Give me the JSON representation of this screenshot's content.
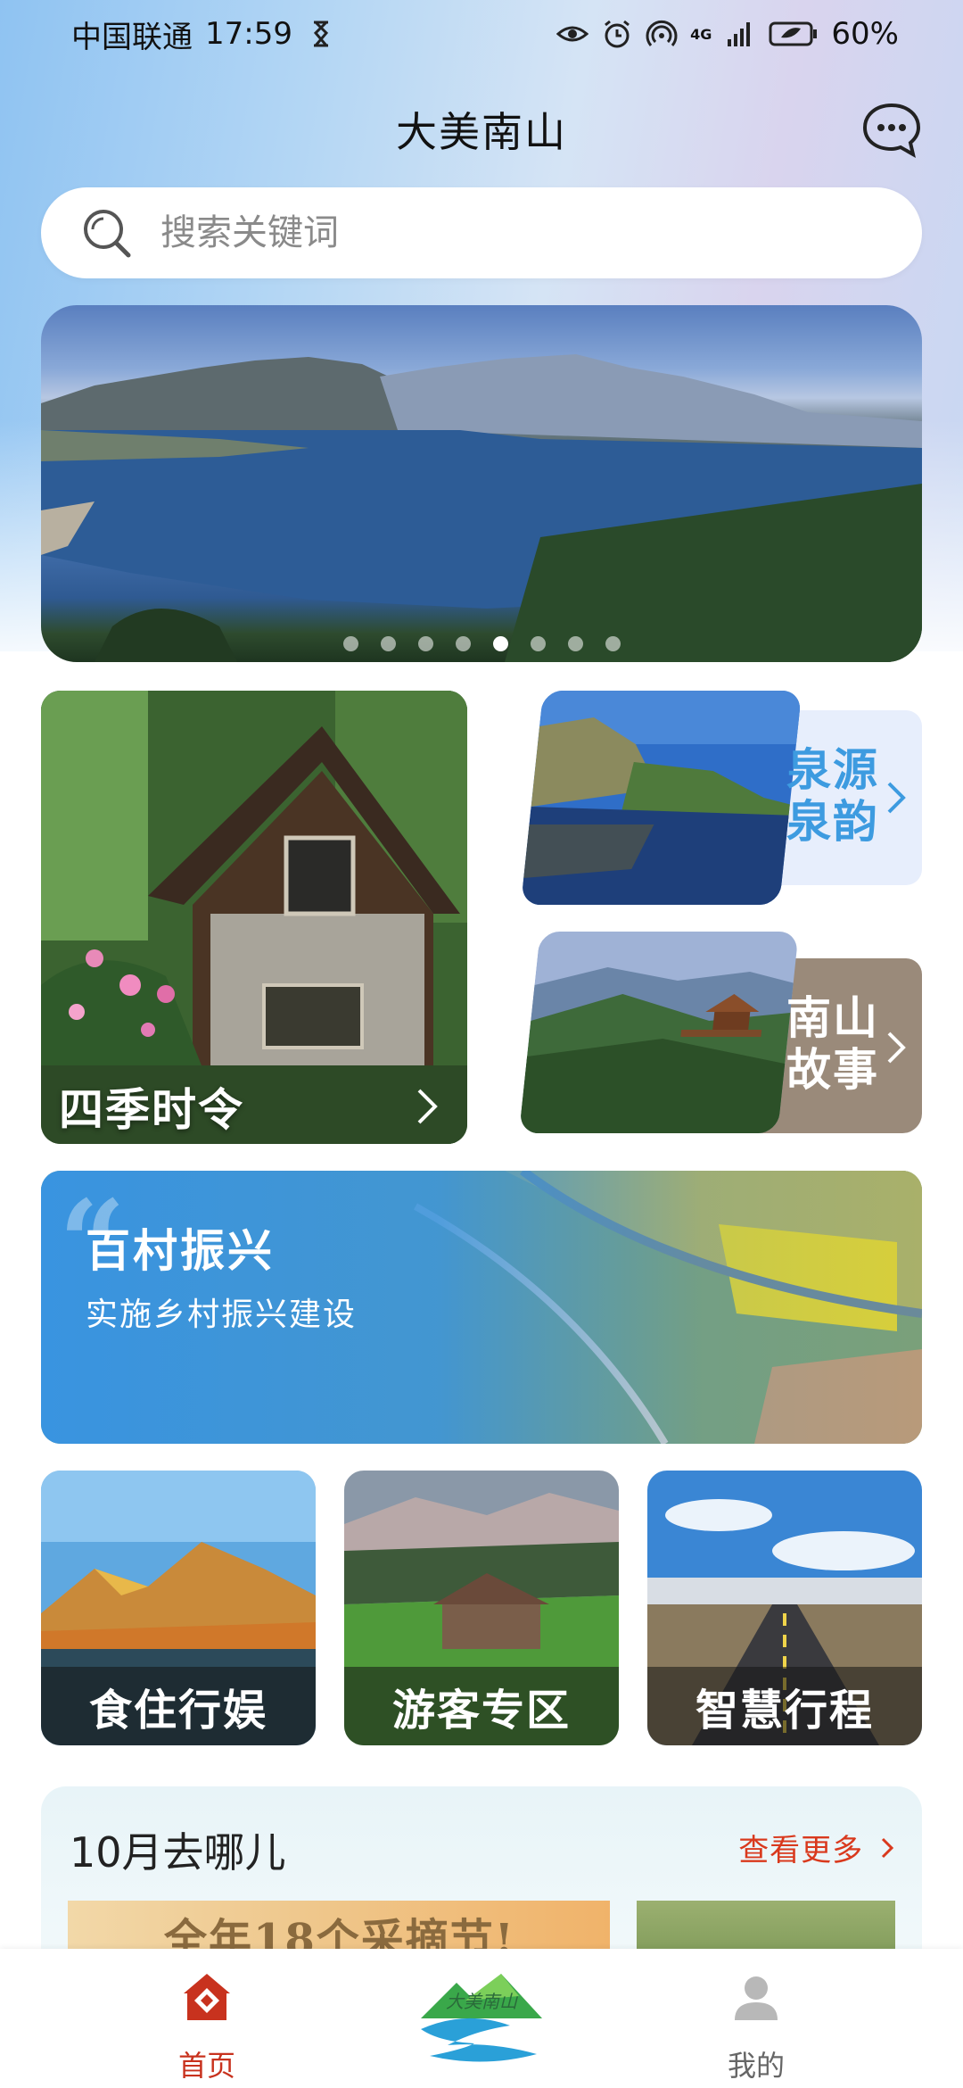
{
  "status_bar": {
    "carrier": "中国联通",
    "time": "17:59",
    "network": "4G",
    "battery": "60%"
  },
  "header": {
    "title": "大美南山"
  },
  "search": {
    "placeholder": "搜索关键词"
  },
  "banner": {
    "dot_count": 8,
    "active_dot": 5
  },
  "features": {
    "seasons_label": "四季时令",
    "spring_label_line1": "泉源",
    "spring_label_line2": "泉韵",
    "story_label_line1": "南山",
    "story_label_line2": "故事"
  },
  "revival": {
    "title": "百村振兴",
    "subtitle": "实施乡村振兴建设"
  },
  "tiles": [
    {
      "label": "食住行娱"
    },
    {
      "label": "游客专区"
    },
    {
      "label": "智慧行程"
    }
  ],
  "month_section": {
    "title": "10月去哪儿",
    "more_label": "查看更多",
    "promo_text": "全年18个采摘节!"
  },
  "bottom_nav": {
    "home_label": "首页",
    "mine_label": "我的",
    "logo_text": "大美南山"
  },
  "colors": {
    "accent_red": "#d9391d",
    "nav_active": "#c8321e",
    "nav_inactive": "#666666",
    "spring_text": "#3d9be0",
    "story_panel": "#9a8a7a"
  }
}
